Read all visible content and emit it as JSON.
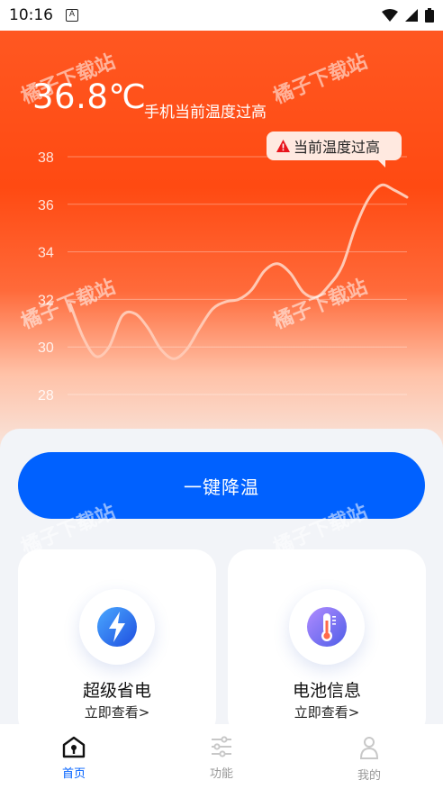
{
  "status_bar": {
    "time": "10:16",
    "notification_icon": "A"
  },
  "header": {
    "temperature": "36.8℃",
    "status_text": "手机当前温度过高"
  },
  "tooltip": {
    "text": "当前温度过高",
    "icon": "warning-icon"
  },
  "chart_data": {
    "type": "line",
    "y_ticks": [
      "38",
      "36",
      "34",
      "32",
      "30",
      "28"
    ],
    "ylim": [
      28,
      38
    ],
    "x": [
      0,
      1,
      2,
      3,
      4,
      5,
      6,
      7,
      8,
      9,
      10,
      11,
      12,
      13,
      14,
      15,
      16,
      17,
      18,
      19,
      20,
      21,
      22,
      23,
      24,
      25,
      26
    ],
    "values": [
      31.8,
      30.4,
      29.6,
      30.0,
      31.3,
      31.4,
      30.8,
      29.9,
      29.5,
      29.9,
      30.8,
      31.6,
      31.9,
      32.0,
      32.4,
      33.2,
      33.5,
      33.1,
      32.3,
      32.1,
      32.6,
      33.4,
      35.0,
      36.2,
      36.8,
      36.6,
      36.3
    ],
    "grid": true,
    "line_color": "#ffc9b4"
  },
  "actions": {
    "cool_down": "一键降温"
  },
  "cards": [
    {
      "title": "超级省电",
      "link": "立即查看>",
      "icon": "lightning-icon"
    },
    {
      "title": "电池信息",
      "link": "立即查看>",
      "icon": "thermometer-icon"
    }
  ],
  "tabs": [
    {
      "label": "首页",
      "icon": "home-icon",
      "active": true
    },
    {
      "label": "功能",
      "icon": "sliders-icon",
      "active": false
    },
    {
      "label": "我的",
      "icon": "person-icon",
      "active": false
    }
  ],
  "watermark": "橘子下载站",
  "colors": {
    "accent": "#0061ff",
    "hero": "#ff4a12"
  }
}
